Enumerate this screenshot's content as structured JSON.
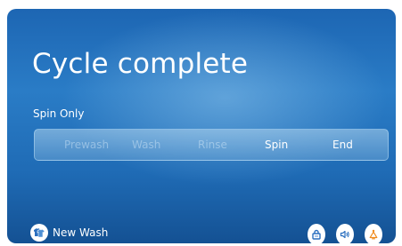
{
  "screen": {
    "title": "Cycle complete",
    "cycle_name": "Spin Only"
  },
  "progress": {
    "stages": [
      {
        "label": "Prewash",
        "state": "done"
      },
      {
        "label": "Wash",
        "state": "done"
      },
      {
        "label": "Rinse",
        "state": "done"
      },
      {
        "label": "Spin",
        "state": "active"
      },
      {
        "label": "End",
        "state": "active"
      }
    ]
  },
  "footer": {
    "new_wash_label": "New Wash",
    "icons": [
      "shirts-icon",
      "child-lock-icon",
      "sound-icon",
      "light-icon"
    ]
  },
  "colors": {
    "background_top": "#1d66b3",
    "background_bottom": "#145193",
    "icon_bg": "#ffffff",
    "icon_blue": "#2a6fbf",
    "light_icon": "#f08a1c"
  }
}
